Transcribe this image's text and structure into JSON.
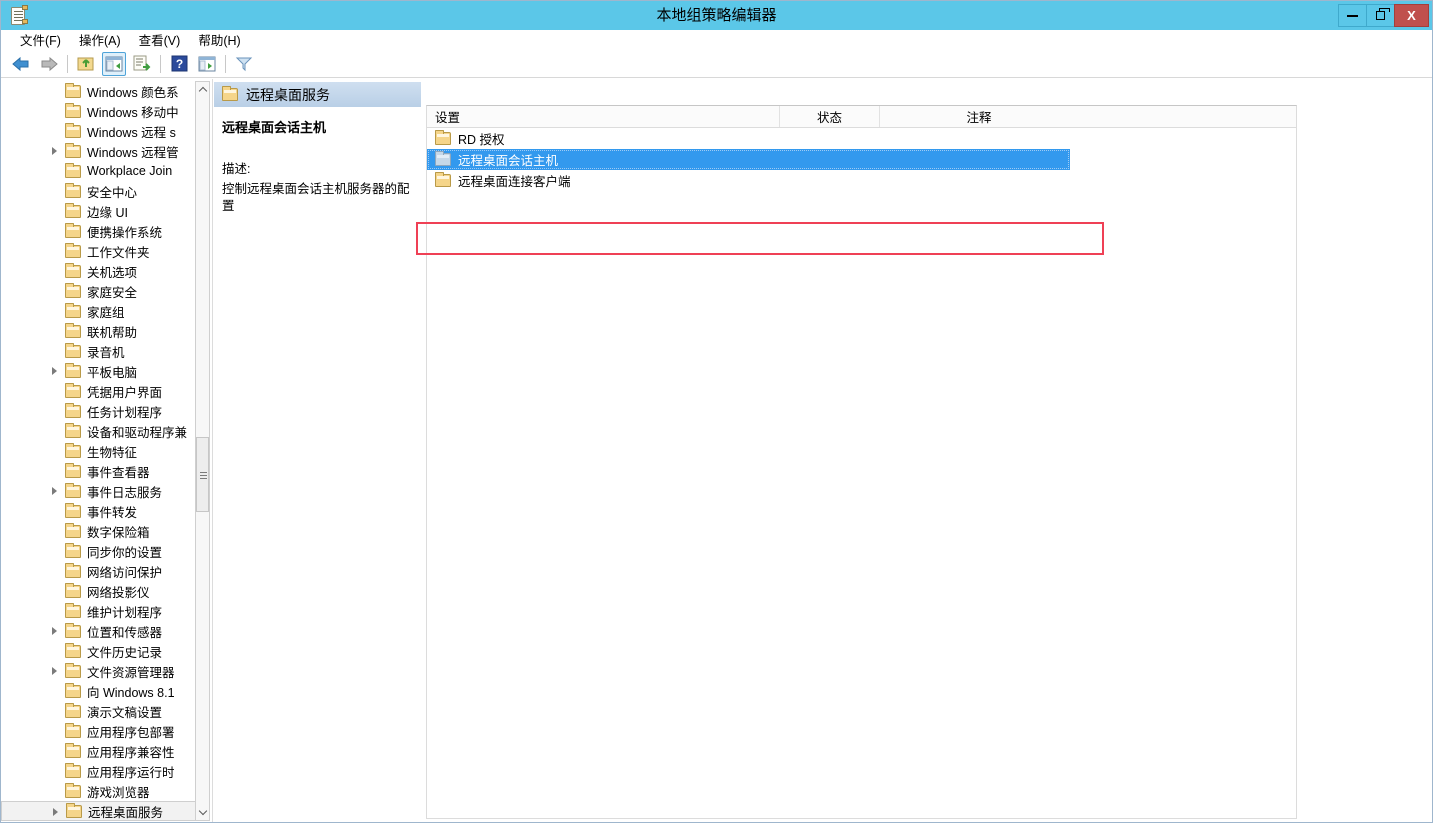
{
  "window": {
    "title": "本地组策略编辑器",
    "icon": "document-icon",
    "controls": {
      "minimize": "—",
      "maximize": "❐",
      "close": "X"
    }
  },
  "menu": {
    "items": [
      {
        "label": "文件(F)",
        "text": "文件",
        "accel": "F"
      },
      {
        "label": "操作(A)",
        "text": "操作",
        "accel": "A"
      },
      {
        "label": "查看(V)",
        "text": "查看",
        "accel": "V"
      },
      {
        "label": "帮助(H)",
        "text": "帮助",
        "accel": "H"
      }
    ]
  },
  "toolbar": {
    "buttons": [
      {
        "name": "back-icon",
        "glyph": "⬅"
      },
      {
        "name": "forward-icon",
        "glyph": "➡"
      },
      {
        "name": "up-folder-icon",
        "glyph": "📂"
      },
      {
        "name": "show-hide-tree-icon",
        "glyph": "▥",
        "active": true
      },
      {
        "name": "export-list-icon",
        "glyph": "📄"
      },
      {
        "name": "help-icon",
        "glyph": "?"
      },
      {
        "name": "show-details-icon",
        "glyph": "▤"
      },
      {
        "name": "filter-icon",
        "glyph": "▽"
      }
    ]
  },
  "tree": {
    "items": [
      {
        "label": "Windows 颜色系",
        "expandable": false,
        "selected": false
      },
      {
        "label": "Windows 移动中",
        "expandable": false,
        "selected": false
      },
      {
        "label": "Windows 远程 s",
        "expandable": false,
        "selected": false
      },
      {
        "label": "Windows 远程管",
        "expandable": true,
        "selected": false
      },
      {
        "label": "Workplace Join",
        "expandable": false,
        "selected": false
      },
      {
        "label": "安全中心",
        "expandable": false,
        "selected": false
      },
      {
        "label": "边缘 UI",
        "expandable": false,
        "selected": false
      },
      {
        "label": "便携操作系统",
        "expandable": false,
        "selected": false
      },
      {
        "label": "工作文件夹",
        "expandable": false,
        "selected": false
      },
      {
        "label": "关机选项",
        "expandable": false,
        "selected": false
      },
      {
        "label": "家庭安全",
        "expandable": false,
        "selected": false
      },
      {
        "label": "家庭组",
        "expandable": false,
        "selected": false
      },
      {
        "label": "联机帮助",
        "expandable": false,
        "selected": false
      },
      {
        "label": "录音机",
        "expandable": false,
        "selected": false
      },
      {
        "label": "平板电脑",
        "expandable": true,
        "selected": false
      },
      {
        "label": "凭据用户界面",
        "expandable": false,
        "selected": false
      },
      {
        "label": "任务计划程序",
        "expandable": false,
        "selected": false
      },
      {
        "label": "设备和驱动程序兼",
        "expandable": false,
        "selected": false
      },
      {
        "label": "生物特征",
        "expandable": false,
        "selected": false
      },
      {
        "label": "事件查看器",
        "expandable": false,
        "selected": false
      },
      {
        "label": "事件日志服务",
        "expandable": true,
        "selected": false
      },
      {
        "label": "事件转发",
        "expandable": false,
        "selected": false
      },
      {
        "label": "数字保险箱",
        "expandable": false,
        "selected": false
      },
      {
        "label": "同步你的设置",
        "expandable": false,
        "selected": false
      },
      {
        "label": "网络访问保护",
        "expandable": false,
        "selected": false
      },
      {
        "label": "网络投影仪",
        "expandable": false,
        "selected": false
      },
      {
        "label": "维护计划程序",
        "expandable": false,
        "selected": false
      },
      {
        "label": "位置和传感器",
        "expandable": true,
        "selected": false
      },
      {
        "label": "文件历史记录",
        "expandable": false,
        "selected": false
      },
      {
        "label": "文件资源管理器",
        "expandable": true,
        "selected": false
      },
      {
        "label": "向 Windows 8.1",
        "expandable": false,
        "selected": false
      },
      {
        "label": "演示文稿设置",
        "expandable": false,
        "selected": false
      },
      {
        "label": "应用程序包部署",
        "expandable": false,
        "selected": false
      },
      {
        "label": "应用程序兼容性",
        "expandable": false,
        "selected": false
      },
      {
        "label": "应用程序运行时",
        "expandable": false,
        "selected": false
      },
      {
        "label": "游戏浏览器",
        "expandable": false,
        "selected": false
      },
      {
        "label": "远程桌面服务",
        "expandable": true,
        "selected": true
      }
    ],
    "scrollbar": {
      "up": "▲",
      "down": "▼"
    }
  },
  "content": {
    "header_title": "远程桌面服务",
    "description": {
      "title": "远程桌面会话主机",
      "label": "描述:",
      "text": "控制远程桌面会话主机服务器的配置"
    },
    "listview": {
      "columns": [
        "设置",
        "状态",
        "注释"
      ],
      "rows": [
        {
          "label": "RD 授权",
          "state": "",
          "comment": "",
          "selected": false
        },
        {
          "label": "远程桌面会话主机",
          "state": "",
          "comment": "",
          "selected": true
        },
        {
          "label": "远程桌面连接客户端",
          "state": "",
          "comment": "",
          "selected": false
        }
      ]
    }
  },
  "annotation": {
    "color": "#ef4055",
    "target": "远程桌面会话主机"
  }
}
